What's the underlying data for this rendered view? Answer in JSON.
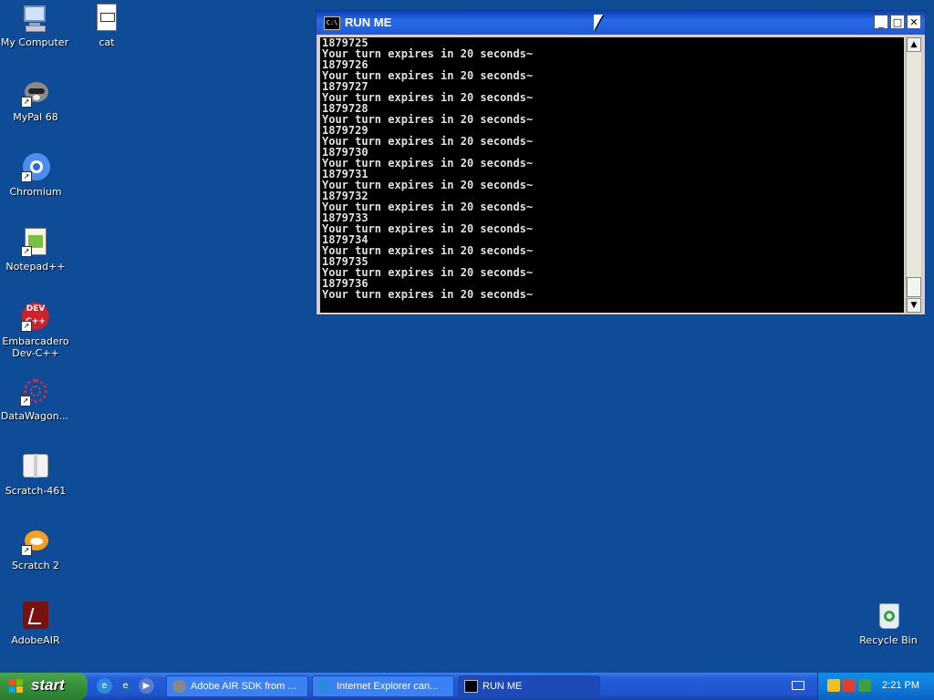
{
  "desktop": {
    "icons": [
      {
        "label": "My Computer"
      },
      {
        "label": "cat"
      },
      {
        "label": "MyPal 68"
      },
      {
        "label": "Chromium"
      },
      {
        "label": "Notepad++"
      },
      {
        "label": "Embarcadero Dev-C++"
      },
      {
        "label": "DataWagon..."
      },
      {
        "label": "Scratch-461"
      },
      {
        "label": "Scratch 2"
      },
      {
        "label": "AdobeAIR"
      },
      {
        "label": "Recycle Bin"
      }
    ]
  },
  "window": {
    "title": "RUN ME",
    "icon_text": "C:\\",
    "buttons": {
      "minimize": "_",
      "maximize": "□",
      "close": "✕"
    },
    "console_lines": [
      "1879725",
      "Your turn expires in 20 seconds~",
      "1879726",
      "Your turn expires in 20 seconds~",
      "1879727",
      "Your turn expires in 20 seconds~",
      "1879728",
      "Your turn expires in 20 seconds~",
      "1879729",
      "Your turn expires in 20 seconds~",
      "1879730",
      "Your turn expires in 20 seconds~",
      "1879731",
      "Your turn expires in 20 seconds~",
      "1879732",
      "Your turn expires in 20 seconds~",
      "1879733",
      "Your turn expires in 20 seconds~",
      "1879734",
      "Your turn expires in 20 seconds~",
      "1879735",
      "Your turn expires in 20 seconds~",
      "1879736",
      "Your turn expires in 20 seconds~"
    ]
  },
  "taskbar": {
    "start_label": "start",
    "tasks": [
      {
        "label": "Adobe AIR SDK from ...",
        "icon": "raccoon-icon"
      },
      {
        "label": "Internet Explorer can...",
        "icon": "ie-icon"
      },
      {
        "label": "RUN ME",
        "icon": "console-icon"
      }
    ],
    "clock": "2:21 PM"
  },
  "colors": {
    "desktop": "#0f4c98",
    "taskbar": "#245edb",
    "start": "#35913a",
    "console_bg": "#000000",
    "console_fg": "#e0e0e0"
  }
}
